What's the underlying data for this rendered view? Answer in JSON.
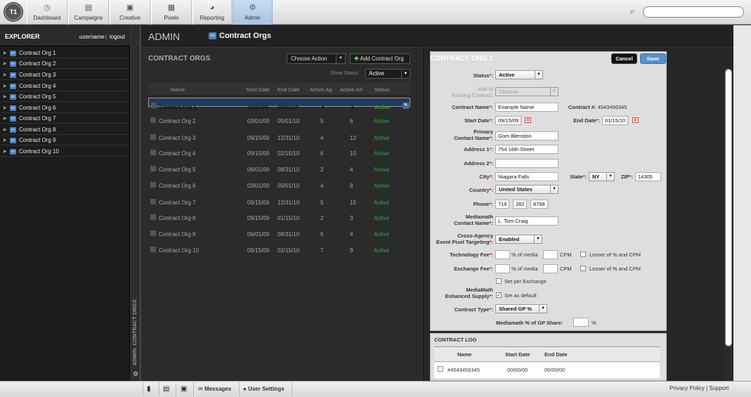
{
  "nav": {
    "logo": "T1",
    "items": [
      {
        "label": "Dashboard",
        "icon": "dashboard-icon"
      },
      {
        "label": "Campaigns",
        "icon": "campaigns-icon"
      },
      {
        "label": "Creative",
        "icon": "creative-icon"
      },
      {
        "label": "Pixels",
        "icon": "pixels-icon"
      },
      {
        "label": "Reporting",
        "icon": "reporting-icon"
      },
      {
        "label": "Admin",
        "icon": "gear-icon",
        "active": true
      }
    ],
    "search_placeholder": ""
  },
  "explorer": {
    "title": "EXPLORER",
    "username": "username",
    "separator": "|",
    "logout": "logout",
    "items": [
      "Contract Org 1",
      "Contract Org 2",
      "Contract Org 3",
      "Contract Org 4",
      "Contract Org 5",
      "Contract Org 6",
      "Contract Org 7",
      "Contract Org 8",
      "Contract Org 9",
      "Contract Org 10"
    ],
    "badge": "co"
  },
  "sidebar_label": "ADMIN: CONTRACT ORGS",
  "header": {
    "section": "ADMIN",
    "badge": "co",
    "title": "Contract Orgs"
  },
  "list": {
    "title": "CONTRACT ORGS",
    "choose_action": "Choose Action",
    "add_button": "Add Contract Org",
    "show_status_label": "Show Status:",
    "status_filter": "Active",
    "columns": [
      "Name",
      "Start Date",
      "End Date",
      "Active Ag",
      "Active Ad",
      "Status"
    ],
    "rows": [
      {
        "name": "Contract Org 1",
        "start": "01/01/09",
        "end": "08/31/10",
        "ag": "4",
        "ad": "3",
        "status": "Active",
        "selected": true
      },
      {
        "name": "Contract Org 2",
        "start": "03/01/09",
        "end": "05/01/10",
        "ag": "5",
        "ad": "6",
        "status": "Active"
      },
      {
        "name": "Contract Org 3",
        "start": "09/15/09",
        "end": "12/31/10",
        "ag": "4",
        "ad": "12",
        "status": "Active"
      },
      {
        "name": "Contract Org 4",
        "start": "09/15/09",
        "end": "02/15/10",
        "ag": "6",
        "ad": "10",
        "status": "Active"
      },
      {
        "name": "Contract Org 5",
        "start": "06/01/09",
        "end": "08/31/10",
        "ag": "2",
        "ad": "4",
        "status": "Active"
      },
      {
        "name": "Contract Org 6",
        "start": "03/01/09",
        "end": "05/01/10",
        "ag": "4",
        "ad": "8",
        "status": "Active"
      },
      {
        "name": "Contract Org 7",
        "start": "09/15/09",
        "end": "12/31/10",
        "ag": "5",
        "ad": "15",
        "status": "Active"
      },
      {
        "name": "Contract Org 8",
        "start": "09/15/09",
        "end": "01/15/10",
        "ag": "2",
        "ad": "3",
        "status": "Active"
      },
      {
        "name": "Contract Org 9",
        "start": "06/01/09",
        "end": "08/31/10",
        "ag": "5",
        "ad": "4",
        "status": "Active"
      },
      {
        "name": "Contract Org 10",
        "start": "09/15/09",
        "end": "02/15/10",
        "ag": "7",
        "ad": "9",
        "status": "Active"
      }
    ]
  },
  "detail": {
    "title": "CONTRACT ORG 1",
    "cancel": "Cancel",
    "save": "Save",
    "status_label": "Status",
    "status_value": "Active",
    "add_existing_label1": "Add to",
    "add_existing_label2": "Existing Contract:",
    "add_existing_value": "Choose",
    "contract_name_label": "Contract Name",
    "contract_name": "Example Name",
    "contract_num_label": "Contract #:",
    "contract_num": "4543456345",
    "start_label": "Start Date",
    "start": "09/15/09",
    "end_label": "End Date",
    "end": "01/15/10",
    "primary_label1": "Primary",
    "primary_label2": "Contact Name",
    "primary": "Gom Blenston",
    "addr1_label": "Address 1",
    "addr1": "754 16th Street",
    "addr2_label": "Address 2",
    "addr2": "",
    "city_label": "City",
    "city": "Niagara Falls",
    "state_label": "State",
    "state": "NY",
    "zip_label": "ZIP",
    "zip": "14305",
    "country_label": "Country",
    "country": "United States",
    "phone_label": "Phone",
    "phone": [
      "716",
      "282",
      "8768"
    ],
    "mm_label1": "Mediamath",
    "mm_label2": "Contact Name",
    "mm_contact": "L. Tom Craig",
    "cross_label1": "Cross-Agency",
    "cross_label2": "Event Pixel Targeting",
    "cross_value": "Enabled",
    "tech_label": "Technology Fee",
    "exch_label": "Exchange Fee",
    "pct_media": "% of media",
    "cpm": "CPM",
    "lesser": "Lesser of % and CPM",
    "per_exchange": "Set per Exchange",
    "supply_label1": "MediaMath",
    "supply_label2": "Enhanced Supply",
    "set_default": "Set as default",
    "ctype_label": "Contract Type",
    "ctype_value": "Shared GP %",
    "gp_share_label": "Mediamath % of GP Share:",
    "gp_pct": "%",
    "req": "*",
    "colon": ":"
  },
  "log": {
    "title": "CONTRACT LOG",
    "columns": [
      "Name",
      "Start Date",
      "End Date"
    ],
    "row": {
      "name": "#4543456345",
      "start": "00/00/00",
      "end": "00/00/00"
    }
  },
  "bottom": {
    "messages": "Messages",
    "user_settings": "User Settings",
    "privacy": "Privacy Policy",
    "sep": "|",
    "support": "Support"
  },
  "colors": {
    "accent": "#5a8fc8",
    "status_active": "#3aa83a",
    "required": "#d02020"
  }
}
